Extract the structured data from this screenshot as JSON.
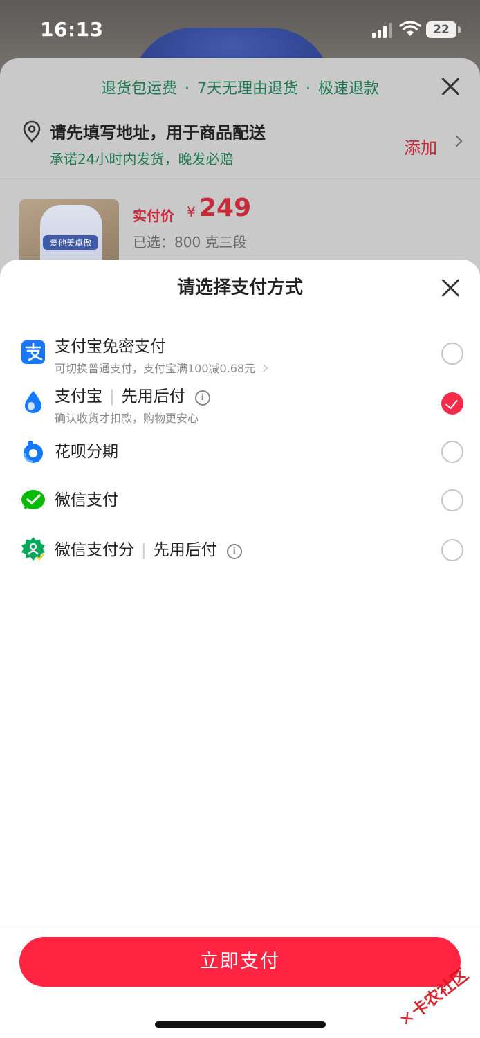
{
  "status_bar": {
    "time": "16:13",
    "battery": "22"
  },
  "promo_bar": {
    "items": [
      "退货包运费",
      "7天无理由退货",
      "极速退款"
    ],
    "separator": "·"
  },
  "address": {
    "title": "请先填写地址，用于商品配送",
    "subtitle": "承诺24小时内发货，晚发必赔",
    "action": "添加"
  },
  "product": {
    "image_label": "爱他美卓傲",
    "price_label": "实付价",
    "currency": "¥",
    "price": "249",
    "selected": "已选：800 克三段"
  },
  "payment_sheet": {
    "title": "请选择支付方式",
    "methods": [
      {
        "name": "支付宝免密支付",
        "tag": "",
        "subtitle": "可切换普通支付，支付宝满100减0.68元",
        "icon": "alipay-icon",
        "selected": false
      },
      {
        "name": "支付宝",
        "tag": "先用后付",
        "subtitle": "确认收货才扣款，购物更安心",
        "icon": "alipay-drop-icon",
        "selected": true
      },
      {
        "name": "花呗分期",
        "tag": "",
        "subtitle": "",
        "icon": "huabei-icon",
        "selected": false
      },
      {
        "name": "微信支付",
        "tag": "",
        "subtitle": "",
        "icon": "wechat-pay-icon",
        "selected": false
      },
      {
        "name": "微信支付分",
        "tag": "先用后付",
        "subtitle": "",
        "icon": "wechat-score-icon",
        "selected": false
      }
    ],
    "pay_button": "立即支付"
  },
  "watermark": "卡农社区",
  "colors": {
    "accent": "#ff2442",
    "promo_green": "#1e7a53",
    "price_red": "#c92a3a"
  }
}
